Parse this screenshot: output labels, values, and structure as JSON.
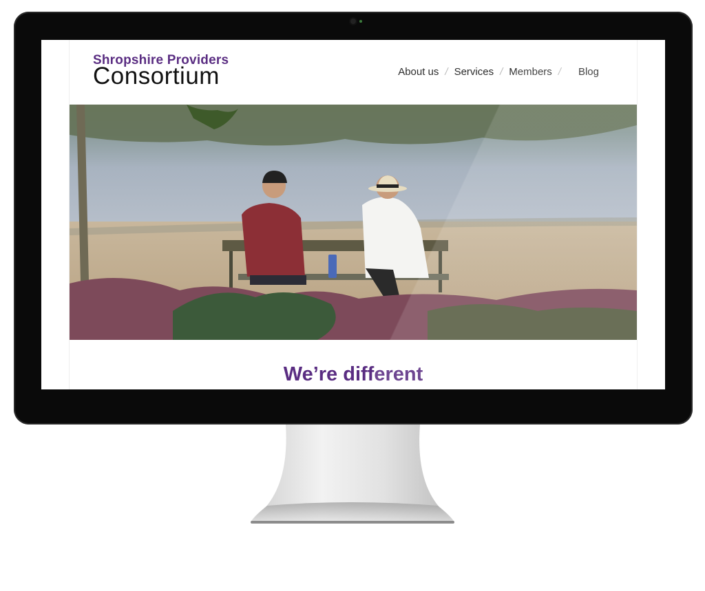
{
  "site": {
    "logo_line1": "Shropshire Providers",
    "logo_line2": "Consortium"
  },
  "nav": {
    "items": [
      "About us",
      "Services",
      "Members",
      "Blog"
    ]
  },
  "hero": {
    "heading": "We’re different"
  },
  "colors": {
    "brand_purple": "#5a2d82",
    "bezel": "#0a0a0a"
  }
}
